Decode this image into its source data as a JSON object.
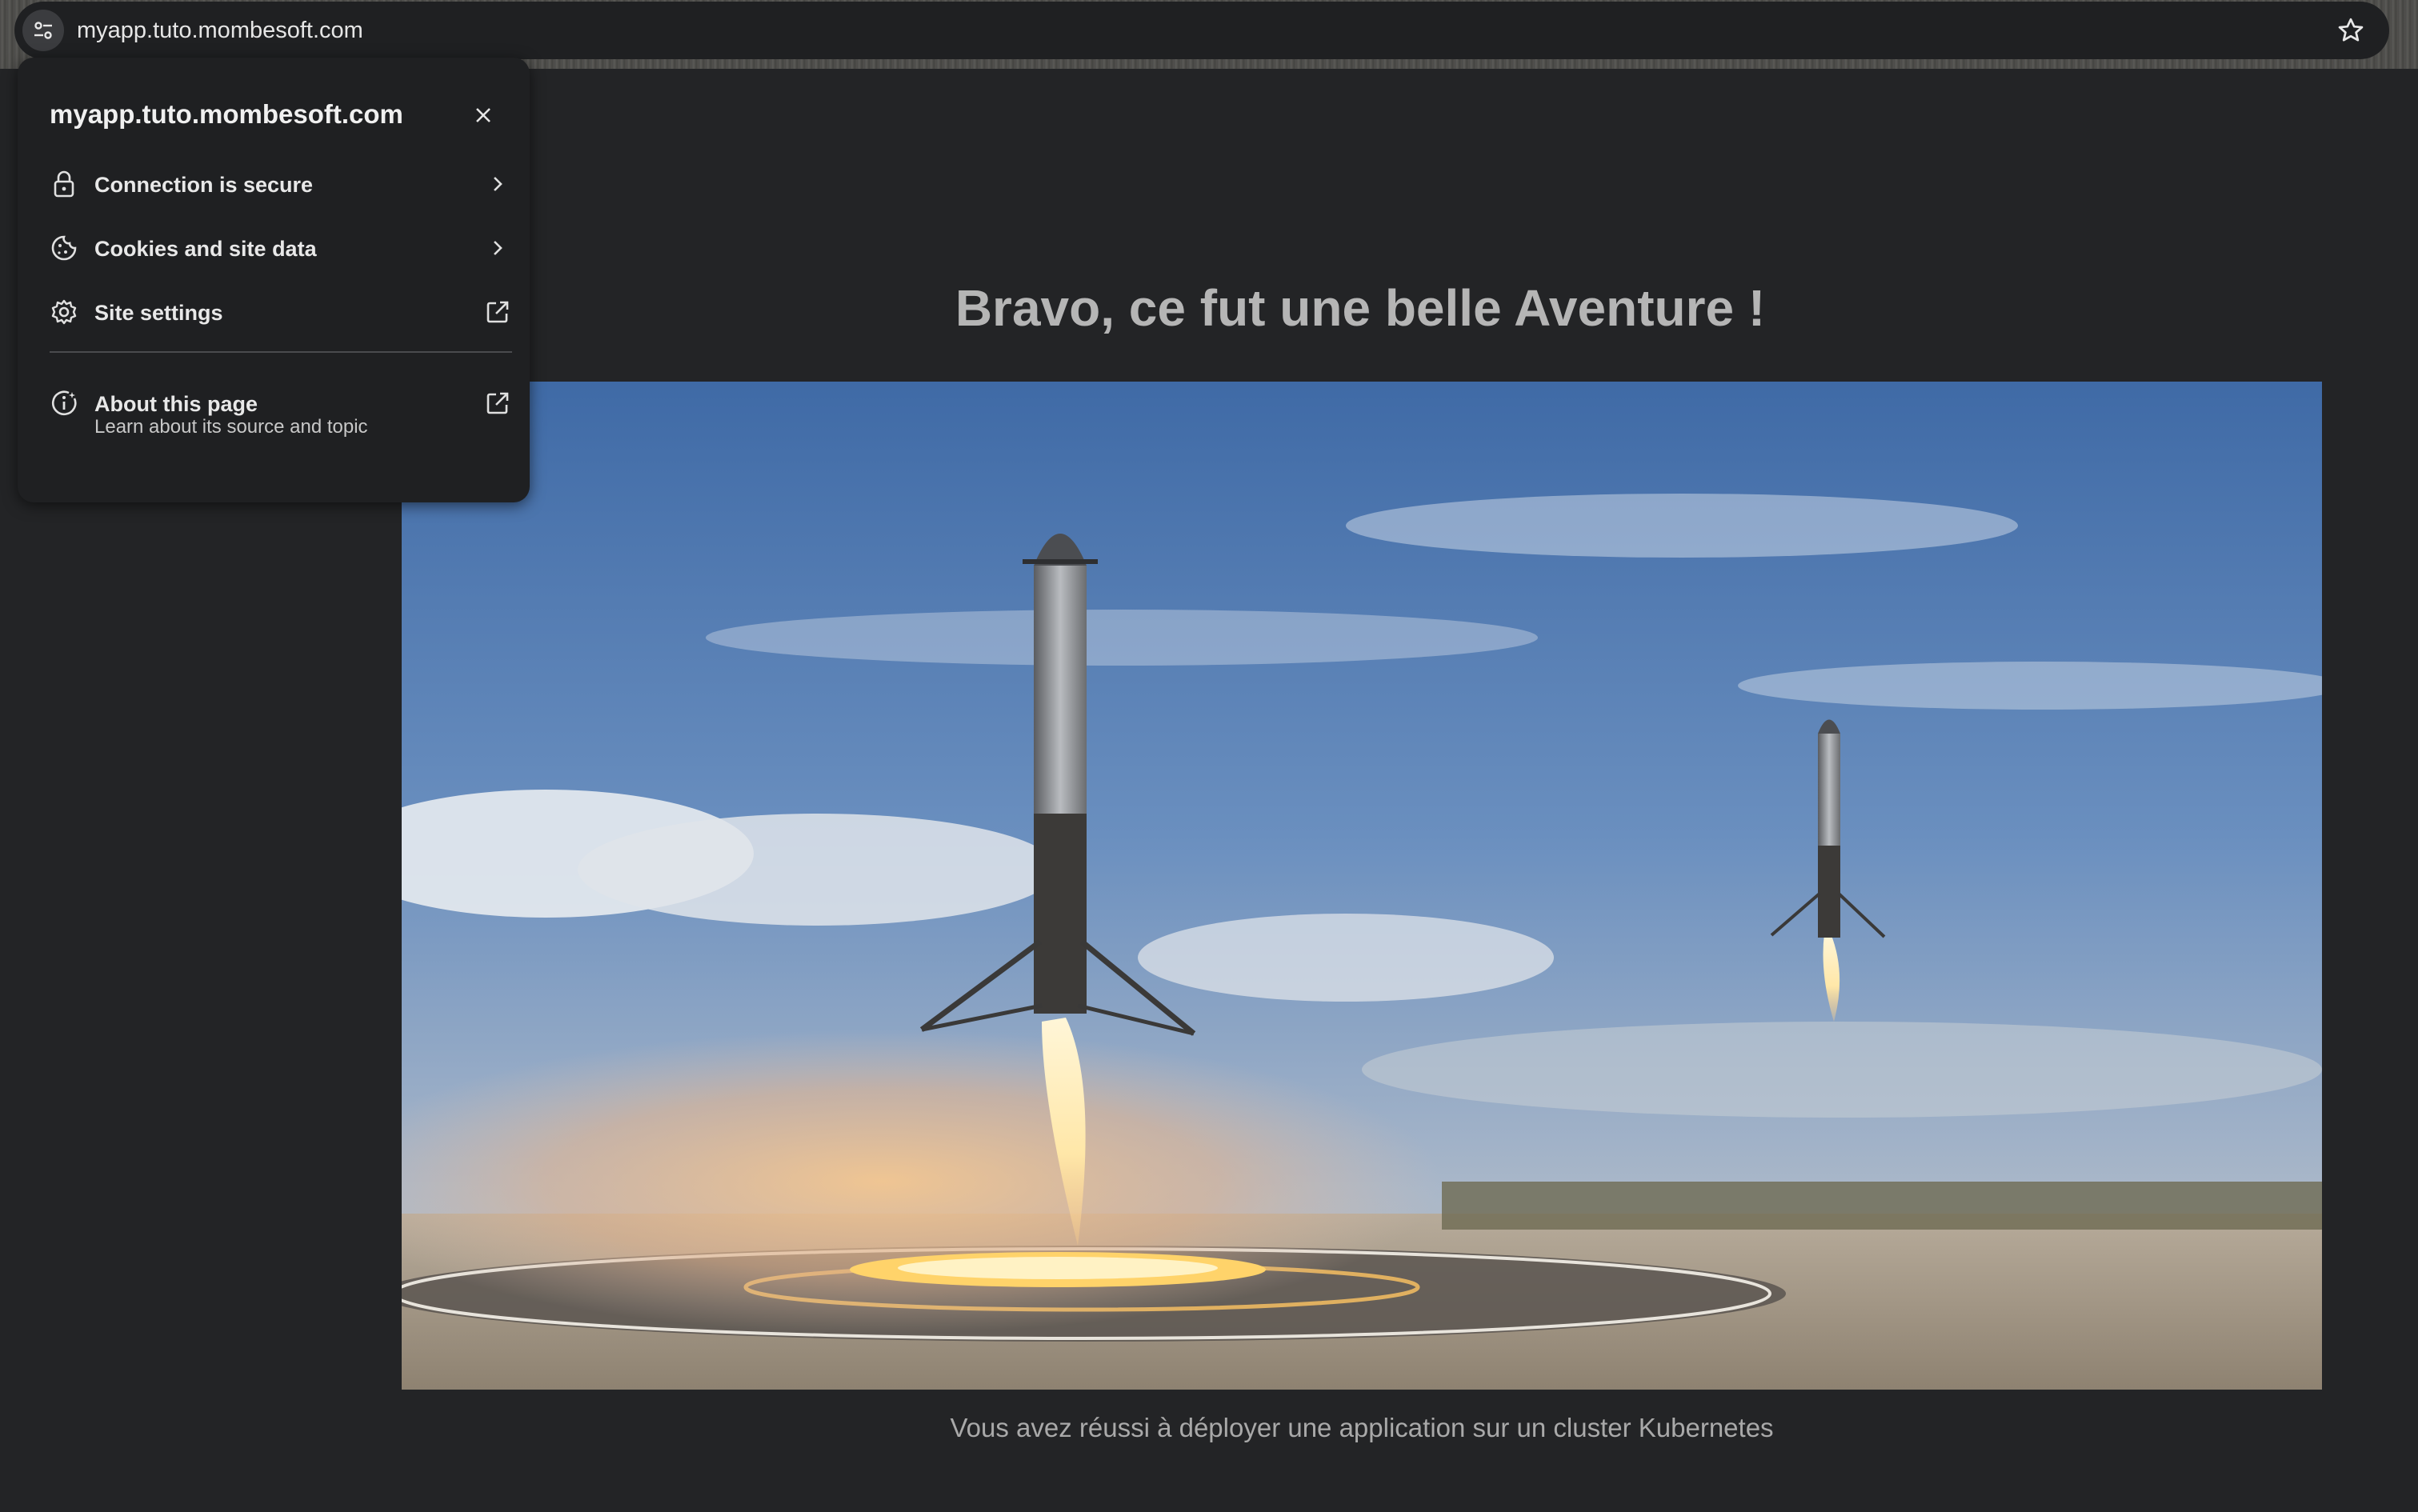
{
  "browser": {
    "url": "myapp.tuto.mombesoft.com",
    "site_info_icon": "tune-icon",
    "bookmark_icon": "star-icon"
  },
  "page": {
    "heading": "Bravo, ce fut une belle Aventure !",
    "image_subject": "two rocket boosters landing side by side",
    "caption": "Vous avez réussi à déployer une application sur un cluster Kubernetes"
  },
  "popup": {
    "title": "myapp.tuto.mombesoft.com",
    "items": [
      {
        "label": "Connection is secure",
        "icon": "lock-icon",
        "trailing": "chevron-right-icon"
      },
      {
        "label": "Cookies and site data",
        "icon": "cookie-icon",
        "trailing": "chevron-right-icon"
      },
      {
        "label": "Site settings",
        "icon": "gear-icon",
        "trailing": "external-link-icon"
      }
    ],
    "about": {
      "label": "About this page",
      "sublabel": "Learn about its source and topic",
      "icon": "info-icon",
      "trailing": "external-link-icon"
    }
  },
  "colors": {
    "page_bg": "#232426",
    "popup_bg": "#1f2022",
    "heading": "#b5b5b5"
  }
}
